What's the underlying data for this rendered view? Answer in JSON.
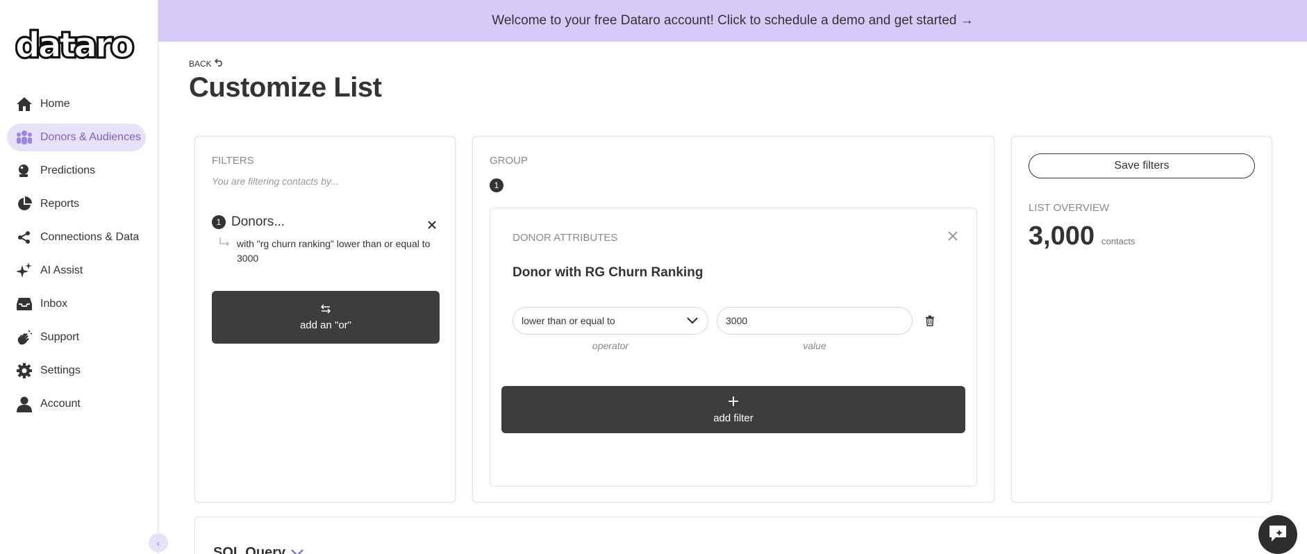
{
  "banner": {
    "text": "Welcome to your free Dataro account! Click to schedule a demo and get started →"
  },
  "logo": {
    "text": "dataro"
  },
  "sidebar": {
    "items": [
      {
        "label": "Home",
        "icon": "home-icon"
      },
      {
        "label": "Donors & Audiences",
        "icon": "people-icon",
        "active": true
      },
      {
        "label": "Predictions",
        "icon": "crystal-ball-icon"
      },
      {
        "label": "Reports",
        "icon": "pie-chart-icon"
      },
      {
        "label": "Connections & Data",
        "icon": "share-icon"
      },
      {
        "label": "AI Assist",
        "icon": "sparkles-icon"
      },
      {
        "label": "Inbox",
        "icon": "inbox-icon"
      },
      {
        "label": "Support",
        "icon": "hand-wave-icon"
      },
      {
        "label": "Settings",
        "icon": "gear-icon"
      },
      {
        "label": "Account",
        "icon": "user-icon"
      }
    ]
  },
  "header": {
    "back_label": "BACK",
    "title": "Customize List"
  },
  "filters": {
    "label": "FILTERS",
    "subtitle": "You are filtering contacts by...",
    "item": {
      "number": "1",
      "title": "Donors...",
      "detail": "with \"rg churn ranking\" lower than or equal to 3000"
    },
    "or_button": "add an \"or\""
  },
  "group": {
    "label": "GROUP",
    "number": "1",
    "attributes_label": "DONOR ATTRIBUTES",
    "attribute_title": "Donor with RG Churn Ranking",
    "operator_value": "lower than or equal to",
    "operator_caption": "operator",
    "value": "3000",
    "value_caption": "value",
    "add_filter_label": "add filter"
  },
  "overview": {
    "save_label": "Save filters",
    "label": "LIST OVERVIEW",
    "count": "3,000",
    "count_unit": "contacts"
  },
  "sql": {
    "title": "SQL Query"
  },
  "colors": {
    "banner_bg": "#d6cbf8",
    "active_nav_bg": "#e8e2f8",
    "active_nav_text": "#7a5fd0",
    "dark_button": "#3d3d40"
  }
}
